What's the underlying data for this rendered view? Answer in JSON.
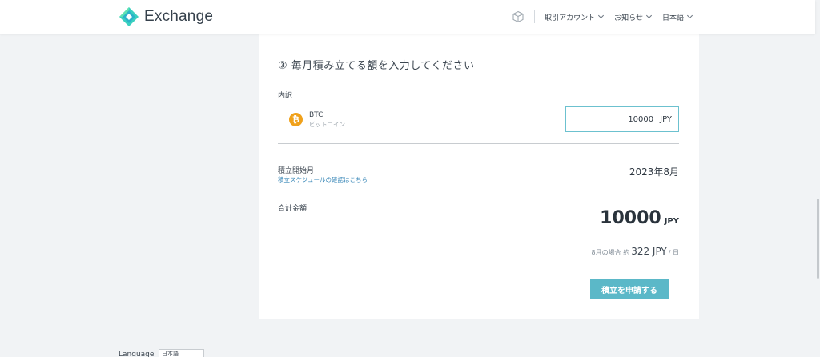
{
  "header": {
    "logo_text": "Exchange",
    "nav": {
      "trading_account": "取引アカウント",
      "notices": "お知らせ",
      "language": "日本語"
    }
  },
  "step": {
    "title": "③ 毎月積み立てる額を入力してください"
  },
  "breakdown": {
    "label": "内訳",
    "coin_symbol": "BTC",
    "coin_name": "ビットコイン",
    "amount": "10000",
    "amount_unit": "JPY"
  },
  "schedule": {
    "label": "積立開始月",
    "link": "積立スケジュールの確認はこちら",
    "start_month": "2023年8月"
  },
  "total": {
    "label": "合計金額",
    "amount": "10000",
    "unit": "JPY",
    "daily_prefix": "8月の場合 約",
    "daily_value": "322 JPY",
    "daily_suffix": "/ 日"
  },
  "submit_label": "積立を申請する",
  "footer": {
    "language_label": "Language",
    "language_value": "日本語"
  },
  "colors": {
    "accent": "#5bb8c8",
    "input_border": "#6cc1cf",
    "btc": "#f0a11b",
    "link": "#3a88b8"
  }
}
